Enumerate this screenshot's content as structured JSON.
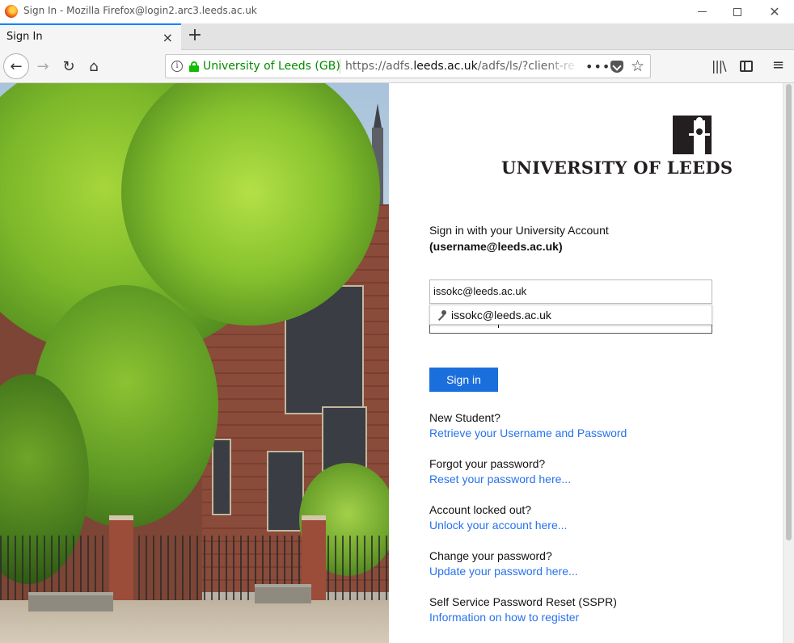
{
  "window": {
    "title": "Sign In - Mozilla Firefox@login2.arc3.leeds.ac.uk",
    "minimize_label": "—",
    "close_label": "✕"
  },
  "tabs": [
    {
      "label": "Sign In",
      "close": "×"
    }
  ],
  "new_tab_label": "+",
  "urlbar": {
    "identity": "University of Leeds (GB)",
    "url_prefix": "https://adfs.",
    "url_domain": "leeds.ac.uk",
    "url_suffix": "/adfs/ls/?client-re",
    "more": "•••",
    "star": "☆",
    "info": "i"
  },
  "toolbar": {
    "back": "←",
    "forward": "→",
    "reload": "↻",
    "home": "⌂",
    "library": "|||\\",
    "menu": "≡"
  },
  "logo": {
    "text": "UNIVERSITY OF LEEDS"
  },
  "form": {
    "intro_line1": "Sign in with your University Account",
    "intro_line2": "(username@leeds.ac.uk)",
    "username_value": "issokc@leeds.ac.uk",
    "password_mask": "●●●●●●●●●●●",
    "autocomplete_suggestion": "issokc@leeds.ac.uk",
    "submit_label": "Sign in"
  },
  "help": [
    {
      "question": "New Student?",
      "link": "Retrieve your Username and Password"
    },
    {
      "question": "Forgot your password?",
      "link": "Reset your password here..."
    },
    {
      "question": "Account locked out?",
      "link": "Unlock your account here..."
    },
    {
      "question": "Change your password?",
      "link": "Update your password here..."
    },
    {
      "question": "Self Service Password Reset (SSPR)",
      "link": "Information on how to register"
    }
  ],
  "colors": {
    "accent_blue": "#1b6fdd",
    "link_blue": "#2672ec",
    "secure_green": "#12bc00",
    "logo_dark": "#231f20"
  }
}
